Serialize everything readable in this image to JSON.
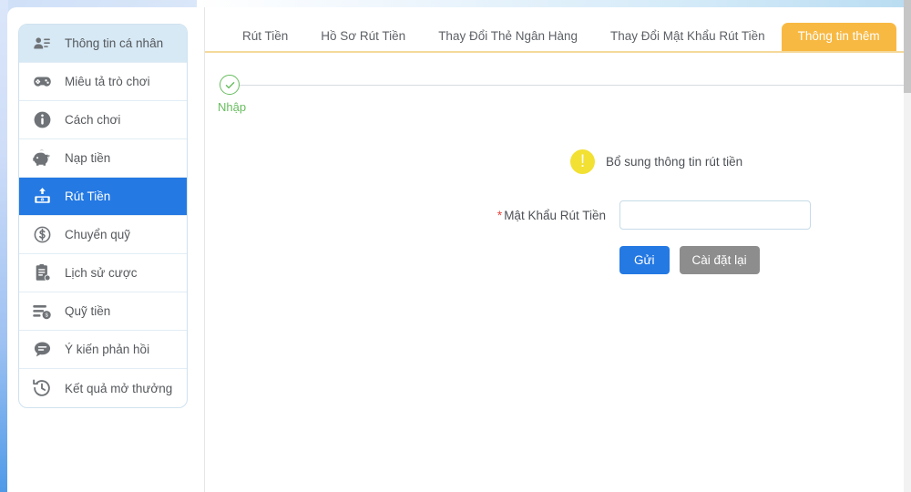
{
  "sidebar": {
    "items": [
      {
        "label": "Thông tin cá nhân",
        "icon": "user-card-icon",
        "state": "highlighted"
      },
      {
        "label": "Miêu tả trò chơi",
        "icon": "gamepad-icon",
        "state": "normal"
      },
      {
        "label": "Cách chơi",
        "icon": "info-circle-icon",
        "state": "normal"
      },
      {
        "label": "Nạp tiền",
        "icon": "piggy-bank-icon",
        "state": "normal"
      },
      {
        "label": "Rút Tiền",
        "icon": "withdraw-cash-icon",
        "state": "active"
      },
      {
        "label": "Chuyển quỹ",
        "icon": "dollar-circle-icon",
        "state": "normal"
      },
      {
        "label": "Lịch sử cược",
        "icon": "clipboard-history-icon",
        "state": "normal"
      },
      {
        "label": "Quỹ tiền",
        "icon": "funds-list-icon",
        "state": "normal"
      },
      {
        "label": "Ý kiến phản hồi",
        "icon": "chat-bubble-icon",
        "state": "normal"
      },
      {
        "label": "Kết quả mở thưởng",
        "icon": "history-clock-icon",
        "state": "normal"
      }
    ]
  },
  "tabs": [
    {
      "label": "Rút Tiền",
      "active": false
    },
    {
      "label": "Hồ Sơ Rút Tiền",
      "active": false
    },
    {
      "label": "Thay Đổi Thẻ Ngân Hàng",
      "active": false
    },
    {
      "label": "Thay Đổi Mật Khẩu Rút Tiền",
      "active": false
    },
    {
      "label": "Thông tin thêm",
      "active": true
    }
  ],
  "stepper": {
    "step_label": "Nhập",
    "step_icon": "check-circle-icon",
    "done_color": "#67bd5e"
  },
  "notice": {
    "icon": "exclamation-circle-icon",
    "glyph": "!",
    "text": "Bổ sung thông tin rút tiền",
    "color": "#f2e033"
  },
  "form": {
    "required_mark": "*",
    "password_label": "Mật Khẩu Rút Tiền",
    "password_value": "",
    "password_placeholder": ""
  },
  "buttons": {
    "submit_label": "Gửi",
    "reset_label": "Cài đặt lại",
    "submit_color": "#2479e3",
    "reset_color": "#8d8d8d"
  },
  "theme": {
    "active_tab_color": "#f8b943",
    "active_sidebar_color": "#2479e3",
    "page_background": "#e8effa"
  }
}
